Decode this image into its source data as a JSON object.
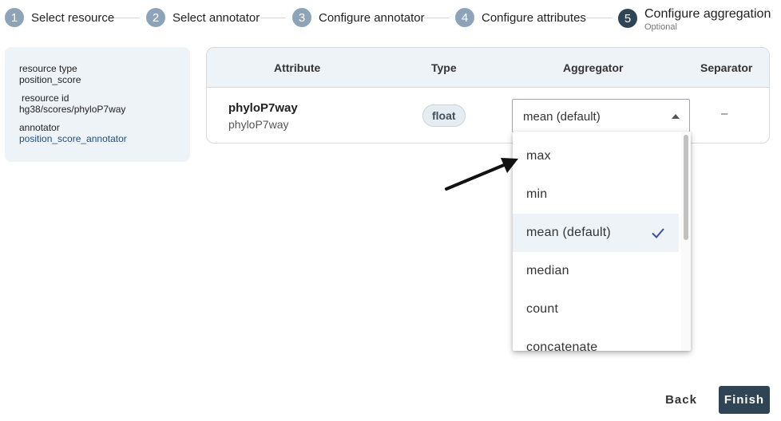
{
  "stepper": {
    "steps": [
      {
        "number": "1",
        "label": "Select resource"
      },
      {
        "number": "2",
        "label": "Select annotator"
      },
      {
        "number": "3",
        "label": "Configure annotator"
      },
      {
        "number": "4",
        "label": "Configure attributes"
      },
      {
        "number": "5",
        "label": "Configure aggregation",
        "sublabel": "Optional"
      }
    ],
    "active_step": 5
  },
  "info": {
    "resource_type_label": "resource type",
    "resource_type_value": "position_score",
    "resource_id_label": "resource id",
    "resource_id_value": "hg38/scores/phyloP7way",
    "annotator_label": "annotator",
    "annotator_value": "position_score_annotator"
  },
  "table": {
    "headers": {
      "attribute": "Attribute",
      "type": "Type",
      "aggregator": "Aggregator",
      "separator": "Separator"
    },
    "rows": [
      {
        "attribute_name": "phyloP7way",
        "attribute_source": "phyloP7way",
        "type": "float",
        "aggregator": "mean (default)",
        "separator": "–"
      }
    ]
  },
  "dropdown": {
    "options": [
      "max",
      "min",
      "mean (default)",
      "median",
      "count",
      "concatenate"
    ],
    "selected": "mean (default)"
  },
  "actions": {
    "back_label": "Back",
    "finish_label": "Finish"
  },
  "colors": {
    "accent": "#2f4455",
    "step_inactive": "#8da4b8",
    "panel_bg": "#eef3f8",
    "check": "#3a4fa3"
  },
  "icons": {
    "select_caret": "caret-up-icon",
    "selected_check": "check-icon",
    "annotation_arrow": "arrow-icon"
  }
}
